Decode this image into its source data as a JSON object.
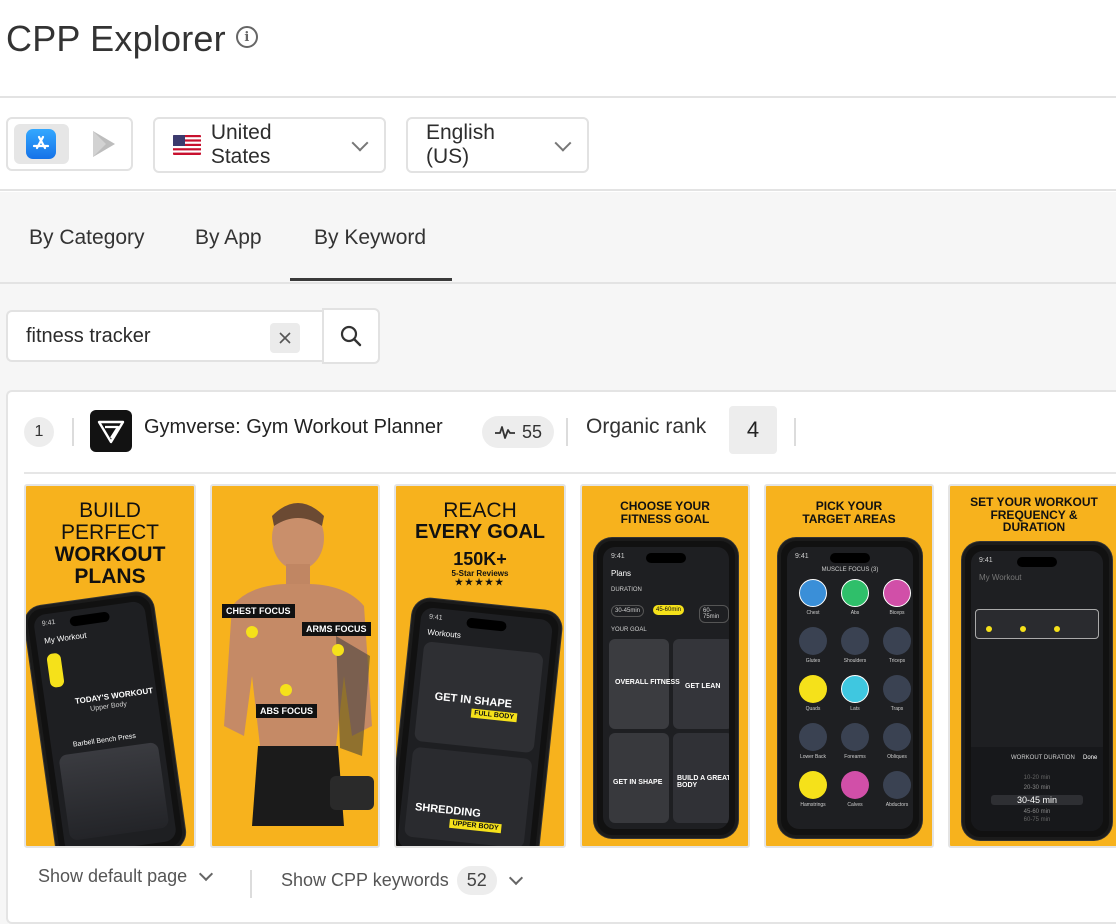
{
  "page": {
    "title": "CPP Explorer"
  },
  "filters": {
    "country": "United States",
    "language": "English (US)"
  },
  "tabs": [
    {
      "label": "By Category"
    },
    {
      "label": "By App"
    },
    {
      "label": "By Keyword"
    }
  ],
  "search": {
    "value": "fitness tracker"
  },
  "result": {
    "rank": "1",
    "app_name": "Gymverse: Gym Workout Planner",
    "score": "55",
    "organic_label": "Organic rank",
    "organic_rank": "4",
    "screenshots": [
      {
        "headline": [
          "BUILD",
          "PERFECT",
          "WORKOUT",
          "PLANS"
        ],
        "labels": [
          "9:41",
          "My Workout",
          "TODAY'S WORKOUT",
          "Upper Body",
          "Barbell Bench Press"
        ]
      },
      {
        "headline": [],
        "labels": [
          "CHEST FOCUS",
          "ARMS FOCUS",
          "ABS FOCUS"
        ]
      },
      {
        "headline": [
          "REACH",
          "EVERY GOAL",
          "150K+",
          "5-Star Reviews"
        ],
        "labels": [
          "9:41",
          "Workouts",
          "GET IN SHAPE",
          "FULL BODY",
          "SHREDDING",
          "UPPER BODY"
        ]
      },
      {
        "headline": [
          "CHOOSE YOUR",
          "FITNESS GOAL"
        ],
        "labels": [
          "9:41",
          "Plans",
          "DURATION",
          "30-45min",
          "45-60min",
          "60-75min",
          "YOUR GOAL",
          "OVERALL FITNESS",
          "GET LEAN",
          "GET IN SHAPE",
          "BUILD A GREAT BODY"
        ]
      },
      {
        "headline": [
          "PICK YOUR",
          "TARGET AREAS"
        ],
        "labels": [
          "9:41",
          "MUSCLE FOCUS (3)",
          "Chest",
          "Abs",
          "Biceps",
          "Glutes",
          "Shoulders",
          "Triceps",
          "Quads",
          "Lats",
          "Traps",
          "Lower Back",
          "Forearms",
          "Obliques",
          "Hamstrings",
          "Calves",
          "Abductors"
        ]
      },
      {
        "headline": [
          "SET YOUR WORKOUT",
          "FREQUENCY &",
          "DURATION"
        ],
        "labels": [
          "9:41",
          "My Workout",
          "WORKOUT DURATION",
          "Done",
          "10-20 min",
          "20-30 min",
          "30-45 min",
          "45-60 min",
          "60-75 min"
        ]
      }
    ],
    "show_default_label": "Show default page",
    "show_cpp_label": "Show CPP keywords",
    "cpp_count": "52"
  },
  "colors": {
    "shot_bg": "#f7b21d",
    "accent_yellow": "#f5e11a",
    "appstore_blue": "#1f8bf5"
  }
}
